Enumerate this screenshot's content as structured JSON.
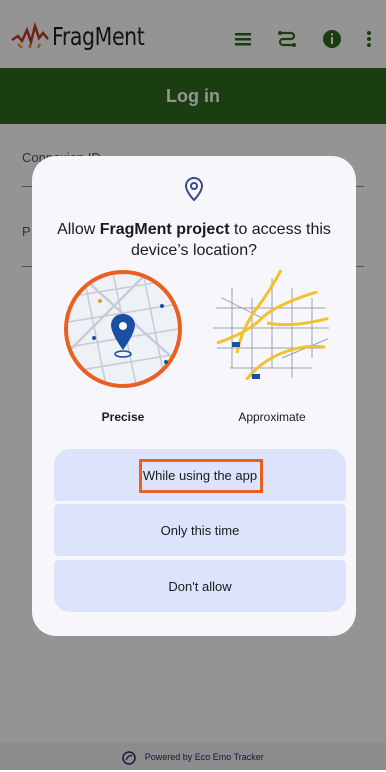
{
  "app": {
    "brand": "FragMent",
    "header_title": "Log in",
    "field_connexion_label": "Connexion ID",
    "field_password_label": "P",
    "footer_text": "Powered by Eco Emo Tracker"
  },
  "dialog": {
    "title_prefix": "Allow ",
    "title_app": "FragMent project",
    "title_suffix": " to access this device’s location?",
    "precise_label": "Precise",
    "approximate_label": "Approximate",
    "buttons": {
      "while_using": "While using the app",
      "only_this_time": "Only this time",
      "dont_allow": "Don't allow"
    }
  },
  "colors": {
    "header_green": "#2e6b1a",
    "precise_ring": "#ea5f22",
    "button_bg": "#dde3fb",
    "pin_blue": "#1a4fa3",
    "highlight": "#ea5f22"
  },
  "icons": [
    "menu-icon",
    "route-icon",
    "info-icon",
    "more-vertical-icon",
    "location-pin-icon",
    "eco-logo-icon"
  ]
}
